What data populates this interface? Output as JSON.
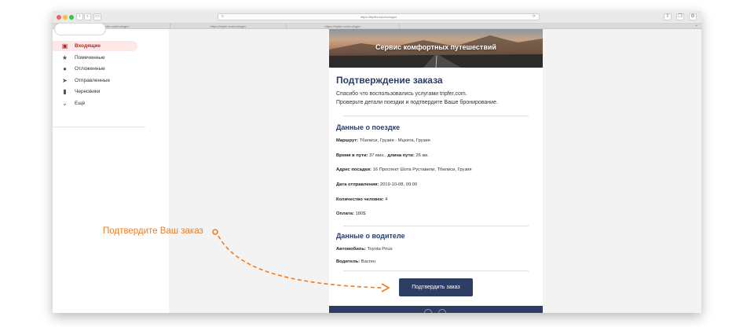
{
  "browser": {
    "url": "https://tripfer.com/ru/login/",
    "url_right": "⟳",
    "tabs": [
      {
        "label": "https://tripfer.com/ru/login/"
      },
      {
        "label": "https://tripfer.com/ru/login/"
      },
      {
        "label": "https://tripfer.com/ru/login/"
      }
    ]
  },
  "sidebar": {
    "items": [
      {
        "label": "Входящие",
        "icon": "inbox-icon",
        "glyph": "▣",
        "active": true
      },
      {
        "label": "Помеченные",
        "icon": "star-icon",
        "glyph": "★"
      },
      {
        "label": "Отложенные",
        "icon": "clock-icon",
        "glyph": "●"
      },
      {
        "label": "Отправленные",
        "icon": "send-icon",
        "glyph": "➤"
      },
      {
        "label": "Черновики",
        "icon": "draft-icon",
        "glyph": "▮"
      },
      {
        "label": "Ещё",
        "icon": "chevron-down-icon",
        "glyph": "⌄"
      }
    ]
  },
  "email": {
    "hero_title": "Сервис комфортных путешествий",
    "heading": "Подтверждение заказа",
    "intro_line1": "Спасибо что воспользовались услугами tripfer.com.",
    "intro_line2": "Проверьте детали поездки и подтвердите Ваше бронирование.",
    "trip": {
      "heading": "Данные о поездке",
      "route_label": "Маршрут:",
      "route_value": " Тбилиси, Грузия - Мцхета, Грузия",
      "time_label": "Время в пути:",
      "time_value": " 37 мин., ",
      "length_label": "длина пути:",
      "length_value": " 26 км.",
      "pickup_label": "Адрес посадки:",
      "pickup_value": " 16 Проспект Шота Руставели, Тбилиси, Грузия",
      "date_label": "Дата отправления:",
      "date_value": " 2019-10-08, 09:00",
      "people_label": "Количество человек:",
      "people_value": " 4",
      "payment_label": "Оплата:",
      "payment_value": " 180$"
    },
    "driver": {
      "heading": "Данные о водителе",
      "car_label": "Автомобиль:",
      "car_value": " Toyota Prius",
      "driver_label": "Водитель:",
      "driver_value": " Васген"
    },
    "confirm_button": "Подтвердить заказ"
  },
  "annotation": {
    "text": "Подтвердите Ваш заказ"
  },
  "colors": {
    "accent": "#2c3e63",
    "annotation": "#f07c22",
    "active_nav": "#c5221f"
  }
}
